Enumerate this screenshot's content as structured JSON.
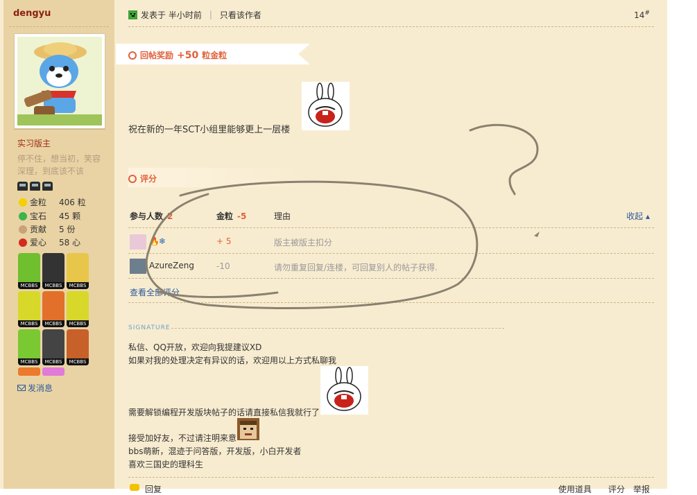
{
  "author": {
    "name": "dengyu"
  },
  "profile": {
    "rank": "实习版主",
    "motto": "停不住，想当初，笑容深理，到底该不该",
    "stats": [
      {
        "icon": "gold-bulb-icon",
        "label": "金粒",
        "value": "406 粒",
        "color": "#f4d000"
      },
      {
        "icon": "gem-icon",
        "label": "宝石",
        "value": "45 颗",
        "color": "#3cb44b"
      },
      {
        "icon": "contribution-icon",
        "label": "贡献",
        "value": "5 份",
        "color": "#c9a27a"
      },
      {
        "icon": "heart-apple-icon",
        "label": "爱心",
        "value": "58 心",
        "color": "#d22b1f"
      }
    ],
    "badge_text": "MCBBS",
    "send_message": "发消息"
  },
  "post": {
    "posted": "发表于 半小时前",
    "only_author": "只看该作者",
    "floor": "14",
    "floor_mark": "#",
    "reward": {
      "label": "回帖奖励",
      "amount": "+50",
      "unit": "粒金粒"
    },
    "content": "祝在新的一年SCT小组里能够更上一层楼"
  },
  "rating": {
    "title": "评分",
    "headers": {
      "participants": "参与人数",
      "participants_count": "2",
      "gold": "金粒",
      "gold_total": "-5",
      "reason": "理由",
      "collapse": "收起"
    },
    "rows": [
      {
        "user": "",
        "gold": "+ 5",
        "reason": "版主被版主扣分"
      },
      {
        "user": "AzureZeng",
        "gold": "-10",
        "reason": "请勿重复回复/连楼，可回复别人的帖子获得."
      }
    ],
    "see_all": "查看全部评分"
  },
  "signature": {
    "label": "SIGNATURE",
    "lines": [
      "私信、QQ开放，欢迎向我提建议XD",
      "如果对我的处理决定有异议的话，欢迎用以上方式私聊我",
      "需要解锁编程开发版块帖子的话请直接私信我就行了",
      "接受加好友，不过请注明来意",
      "bbs萌新，混迹于问答版，开发版，小白开发者",
      "喜欢三国史的理科生"
    ]
  },
  "footer": {
    "reply": "回复",
    "use_item": "使用道具",
    "rate": "评分",
    "report": "举报"
  }
}
